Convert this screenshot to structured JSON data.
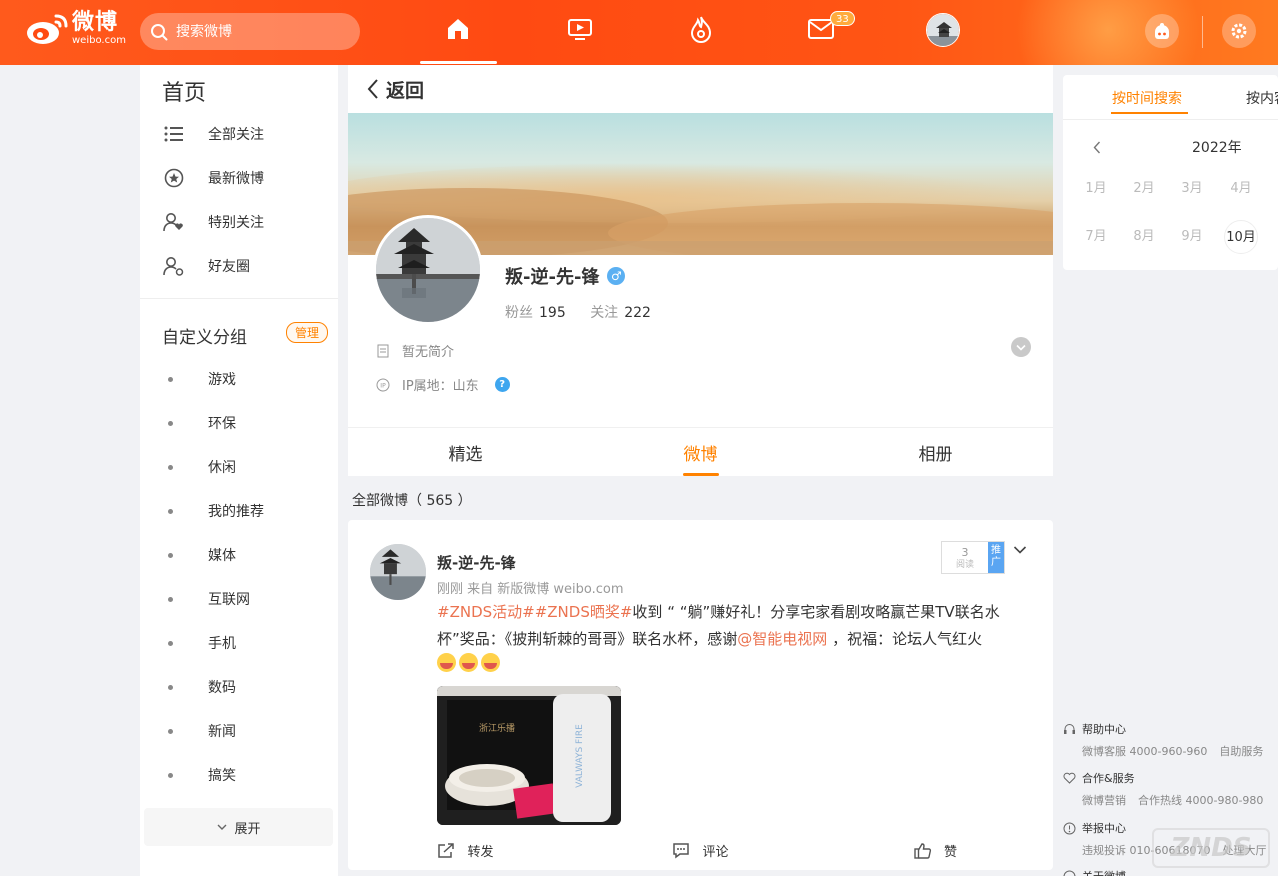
{
  "header": {
    "logo_cn": "微博",
    "logo_en": "weibo.com",
    "search_placeholder": "搜索微博",
    "mail_badge": "33",
    "icons": [
      "home-icon",
      "video-icon",
      "hot-icon",
      "mail-icon",
      "avatar",
      "game-icon",
      "settings-icon"
    ],
    "brand_color": "#ff5a1c"
  },
  "leftnav": {
    "title": "首页",
    "items": [
      {
        "label": "全部关注",
        "icon": "list-icon"
      },
      {
        "label": "最新微博",
        "icon": "star-circle-icon"
      },
      {
        "label": "特别关注",
        "icon": "user-heart-icon"
      },
      {
        "label": "好友圈",
        "icon": "user-friends-icon"
      }
    ],
    "group_title": "自定义分组",
    "manage_label": "管理",
    "groups": [
      "游戏",
      "环保",
      "休闲",
      "我的推荐",
      "媒体",
      "互联网",
      "手机",
      "数码",
      "新闻",
      "搞笑"
    ],
    "expand_label": "展开"
  },
  "main": {
    "back_label": "返回",
    "profile": {
      "name": "叛-逆-先-锋",
      "gender_symbol": "♂",
      "fans_label": "粉丝",
      "fans": "195",
      "follow_label": "关注",
      "follow": "222",
      "bio": "暂无简介",
      "ip": "IP属地：山东",
      "help_symbol": "?"
    },
    "tabs": [
      "精选",
      "微博",
      "相册"
    ],
    "active_tab": "微博",
    "count_label": "全部微博（ 565 ）",
    "post": {
      "author": "叛-逆-先-锋",
      "meta": "刚刚  来自 新版微博 weibo.com",
      "read_count": "3",
      "read_label": "阅读",
      "promote_label": "推广",
      "text_topic": "#ZNDS活动##ZNDS晒奖#",
      "text_body": "收到 “ “躺”赚好礼！分享宅家看剧攻略赢芒果TV联名水杯”奖品：《披荆斩棘的哥哥》联名水杯，感谢",
      "text_mention": "@智能电视网",
      "text_tail": " ，祝福：论坛人气红火",
      "image_caption_cup": "VALWAYS FIRE",
      "image_caption_box": "浙江乐播",
      "actions": [
        {
          "label": "转发",
          "icon": "repost-icon"
        },
        {
          "label": "评论",
          "icon": "comment-icon"
        },
        {
          "label": "赞",
          "icon": "like-icon"
        }
      ]
    }
  },
  "right": {
    "tab_time": "按时间搜索",
    "tab_content": "按内容",
    "year": "2022年",
    "months_row1": [
      "1月",
      "2月",
      "3月",
      "4月"
    ],
    "months_row2": [
      "7月",
      "8月",
      "9月",
      "10月"
    ],
    "selected_month": "10月",
    "accent": "#ff8200"
  },
  "footer": {
    "help_title": "帮助中心",
    "help_links": [
      "微博客服 4000-960-960",
      "自助服务"
    ],
    "coop_title": "合作&服务",
    "coop_links": [
      "微博营销",
      "合作热线 4000-980-980"
    ],
    "report_title": "举报中心",
    "report_links": [
      "违规投诉 010-60618070",
      "处理大厅"
    ],
    "about_title": "关于微博"
  },
  "watermark": "ZNDS"
}
